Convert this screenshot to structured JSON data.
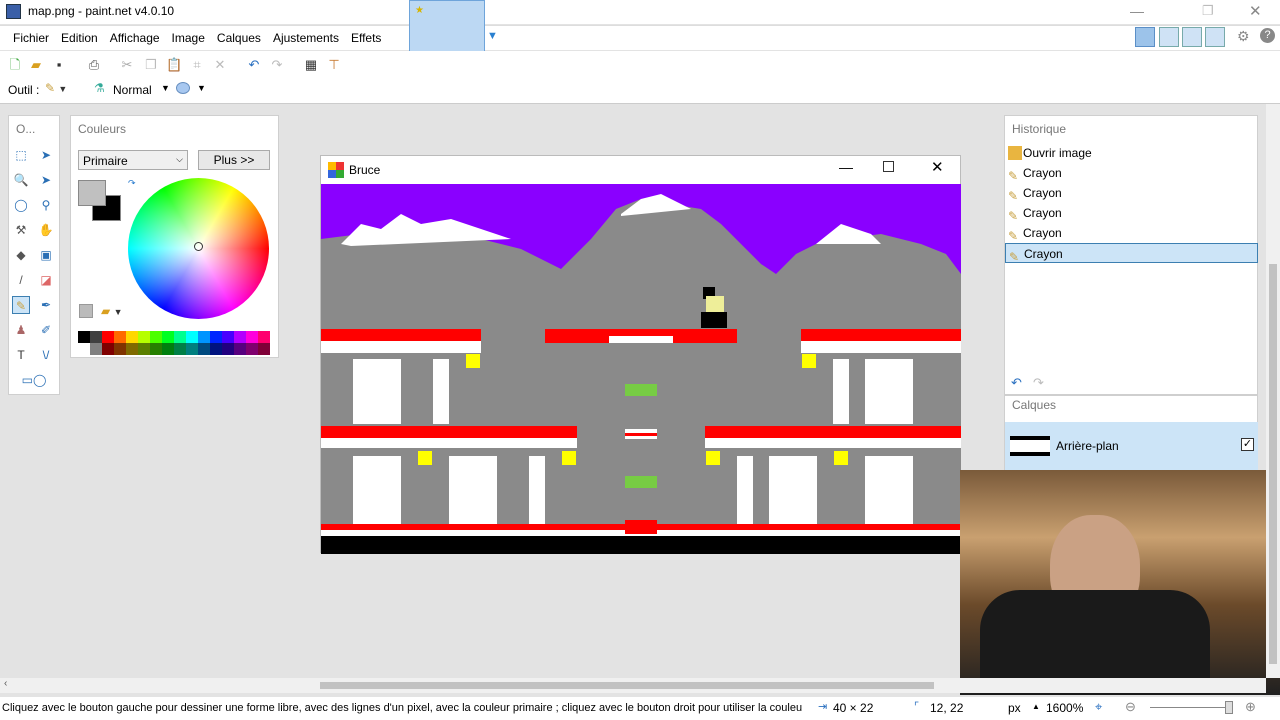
{
  "window": {
    "title": "map.png - paint.net v4.0.10"
  },
  "menu": [
    "Fichier",
    "Edition",
    "Affichage",
    "Image",
    "Calques",
    "Ajustements",
    "Effets"
  ],
  "toolbar": {
    "tool_label": "Outil :",
    "blend_mode": "Normal"
  },
  "tools_panel": {
    "title": "O..."
  },
  "colors_panel": {
    "title": "Couleurs",
    "selector": "Primaire",
    "more_button": "Plus >>",
    "primary": "#c0c0c0",
    "secondary": "#000000",
    "palette": [
      "#000000",
      "#404040",
      "#ff0000",
      "#ff6a00",
      "#ffd800",
      "#b6ff00",
      "#4cff00",
      "#00ff21",
      "#00ff90",
      "#00ffff",
      "#0094ff",
      "#0026ff",
      "#4800ff",
      "#b200ff",
      "#ff00dc",
      "#ff006e",
      "#ffffff",
      "#808080",
      "#7f0000",
      "#7f3300",
      "#7f6a00",
      "#5b7f00",
      "#267f00",
      "#007f0e",
      "#007f46",
      "#007f7f",
      "#004a7f",
      "#00137f",
      "#21007f",
      "#57007f",
      "#7f006e",
      "#7f0037"
    ]
  },
  "game_window": {
    "title": "Bruce"
  },
  "history_panel": {
    "title": "Historique",
    "items": [
      "Ouvrir image",
      "Crayon",
      "Crayon",
      "Crayon",
      "Crayon",
      "Crayon"
    ],
    "selected_index": 5
  },
  "layers_panel": {
    "title": "Calques",
    "layers": [
      {
        "name": "Arrière-plan",
        "visible": true
      }
    ]
  },
  "status": {
    "hint": "Cliquez avec le bouton gauche pour dessiner une forme libre, avec des lignes d'un pixel, avec la couleur primaire ; cliquez avec le bouton droit pour utiliser la couleur secondaire",
    "selection_size": "40 × 22",
    "cursor_pos": "12, 22",
    "unit": "px",
    "zoom": "1600%"
  }
}
